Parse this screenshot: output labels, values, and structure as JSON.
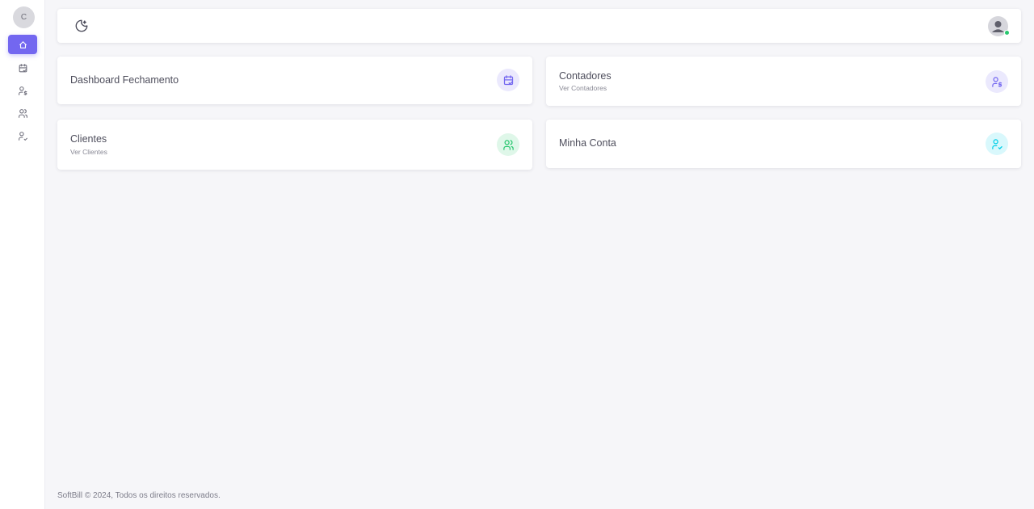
{
  "sidebar": {
    "logo_letter": "C",
    "items": [
      {
        "name": "home",
        "icon": "home-icon",
        "active": true
      },
      {
        "name": "calendar",
        "icon": "calendar-check-icon",
        "active": false
      },
      {
        "name": "accountants",
        "icon": "user-dollar-icon",
        "active": false
      },
      {
        "name": "clients",
        "icon": "users-icon",
        "active": false
      },
      {
        "name": "account",
        "icon": "user-check-icon",
        "active": false
      }
    ]
  },
  "topbar": {
    "theme_icon": "moon-icon",
    "avatar_icon": "user-avatar-icon"
  },
  "cards": {
    "dashboard": {
      "title": "Dashboard Fechamento",
      "icon": "calendar-check-icon"
    },
    "contadores": {
      "title": "Contadores",
      "subtitle": "Ver Contadores",
      "icon": "user-dollar-icon"
    },
    "clientes": {
      "title": "Clientes",
      "subtitle": "Ver Clientes",
      "icon": "users-icon"
    },
    "minha_conta": {
      "title": "Minha Conta",
      "icon": "user-check-icon"
    }
  },
  "colors": {
    "accent": "#7367f0",
    "purple_tint": "#ebe9fd",
    "green": "#28c76f",
    "green_tint": "#dff7e9",
    "cyan": "#00cfe8",
    "cyan_tint": "#d9f8fc"
  },
  "footer": {
    "text": "SoftBill © 2024, Todos os direitos reservados."
  }
}
